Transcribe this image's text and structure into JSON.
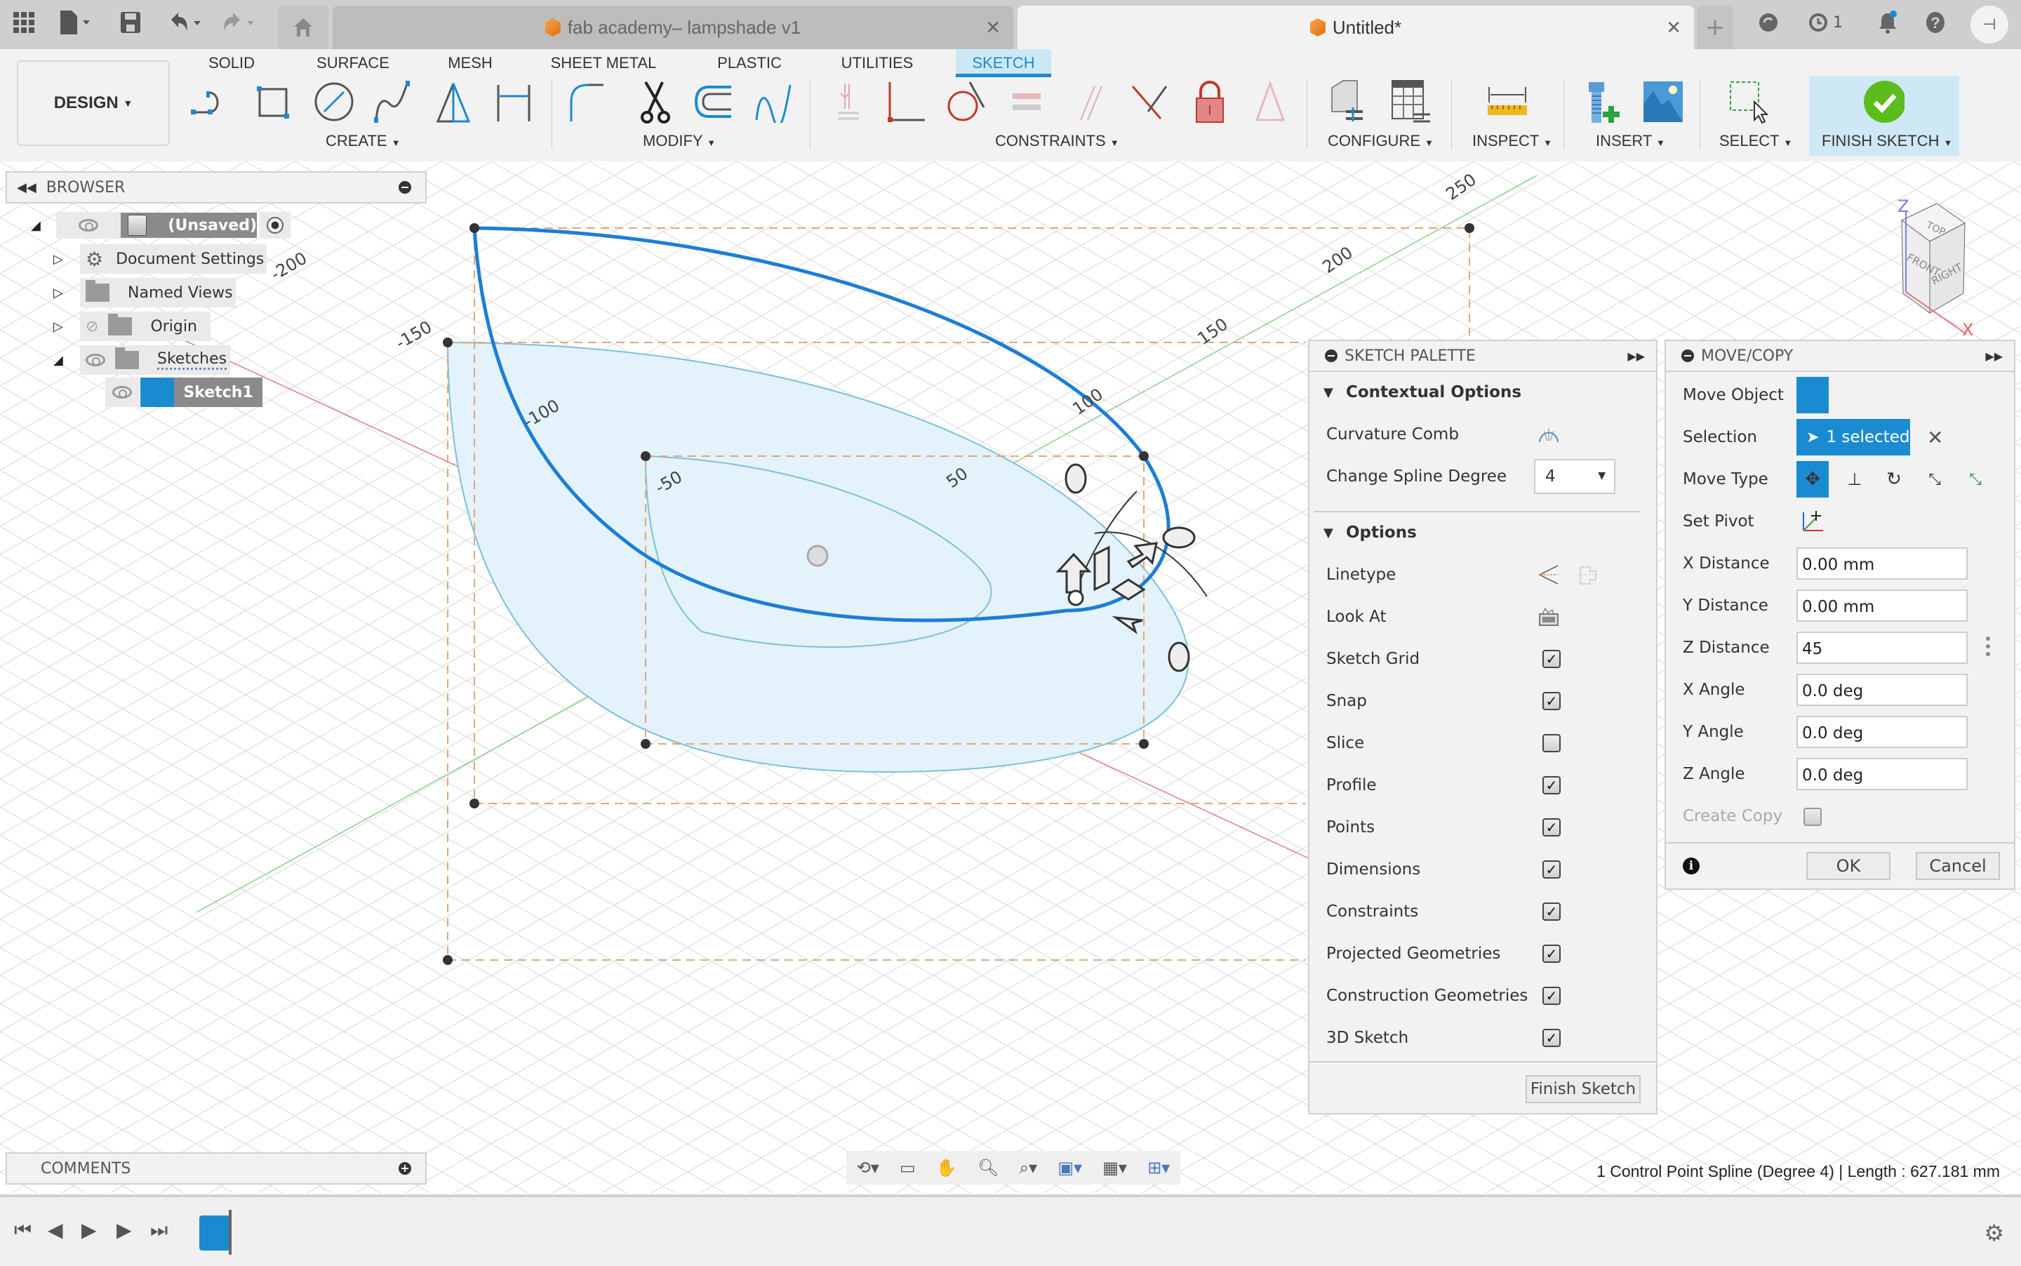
{
  "tabbar": {
    "tabs": [
      {
        "title": "fab academy– lampshade v1",
        "active": false
      },
      {
        "title": "Untitled*",
        "active": true
      }
    ],
    "job_count": "1"
  },
  "toolbar": {
    "workspace": "DESIGN",
    "tabs": [
      "SOLID",
      "SURFACE",
      "MESH",
      "SHEET METAL",
      "PLASTIC",
      "UTILITIES",
      "SKETCH"
    ],
    "active_tab": "SKETCH",
    "groups": {
      "create": "CREATE",
      "modify": "MODIFY",
      "constraints": "CONSTRAINTS",
      "configure": "CONFIGURE",
      "inspect": "INSPECT",
      "insert": "INSERT",
      "select": "SELECT",
      "finish": "FINISH SKETCH"
    },
    "accent": "#1a8bd0"
  },
  "browser": {
    "title": "BROWSER",
    "root": "(Unsaved)",
    "items": [
      "Document Settings",
      "Named Views",
      "Origin",
      "Sketches"
    ],
    "sketch": "Sketch1"
  },
  "viewport": {
    "axis_labels": [
      "-200",
      "-150",
      "-100",
      "-50",
      "50",
      "100",
      "150",
      "200",
      "250"
    ],
    "viewcube": {
      "top": "TOP",
      "front": "FRONT",
      "right": "RIGHT",
      "z": "Z",
      "x": "X"
    }
  },
  "sketch_palette": {
    "title": "SKETCH PALETTE",
    "contextual_heading": "Contextual Options",
    "curvature_comb": "Curvature Comb",
    "spline_degree_label": "Change Spline Degree",
    "spline_degree_value": "4",
    "options_heading": "Options",
    "linetype": "Linetype",
    "look_at": "Look At",
    "options": [
      {
        "label": "Sketch Grid",
        "checked": true
      },
      {
        "label": "Snap",
        "checked": true
      },
      {
        "label": "Slice",
        "checked": false
      },
      {
        "label": "Profile",
        "checked": true
      },
      {
        "label": "Points",
        "checked": true
      },
      {
        "label": "Dimensions",
        "checked": true
      },
      {
        "label": "Constraints",
        "checked": true
      },
      {
        "label": "Projected Geometries",
        "checked": true
      },
      {
        "label": "Construction Geometries",
        "checked": true
      },
      {
        "label": "3D Sketch",
        "checked": true
      }
    ],
    "finish_button": "Finish Sketch"
  },
  "move_copy": {
    "title": "MOVE/COPY",
    "move_object": "Move Object",
    "selection_label": "Selection",
    "selection_value": "1 selected",
    "move_type": "Move Type",
    "set_pivot": "Set Pivot",
    "fields": [
      {
        "label": "X Distance",
        "value": "0.00 mm"
      },
      {
        "label": "Y Distance",
        "value": "0.00 mm"
      },
      {
        "label": "Z Distance",
        "value": "45"
      },
      {
        "label": "X Angle",
        "value": "0.0 deg"
      },
      {
        "label": "Y Angle",
        "value": "0.0 deg"
      },
      {
        "label": "Z Angle",
        "value": "0.0 deg"
      }
    ],
    "create_copy": "Create Copy",
    "create_copy_checked": false,
    "ok": "OK",
    "cancel": "Cancel"
  },
  "status": {
    "text": "1 Control Point Spline (Degree 4) | Length : 627.181 mm"
  },
  "comments": {
    "title": "COMMENTS"
  }
}
